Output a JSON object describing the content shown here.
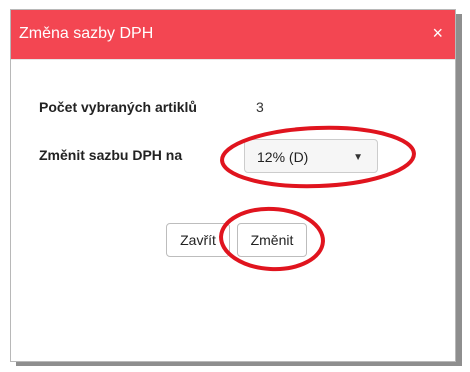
{
  "dialog": {
    "title": "Změna sazby DPH",
    "close_icon": "×"
  },
  "form": {
    "count_label": "Počet vybraných artiklů",
    "count_value": "3",
    "vat_label": "Změnit sazbu DPH na",
    "vat_selected": "12% (D)"
  },
  "footer": {
    "close_label": "Zavřít",
    "change_label": "Změnit"
  },
  "colors": {
    "header": "#f34652",
    "annotation": "#e0141e"
  }
}
